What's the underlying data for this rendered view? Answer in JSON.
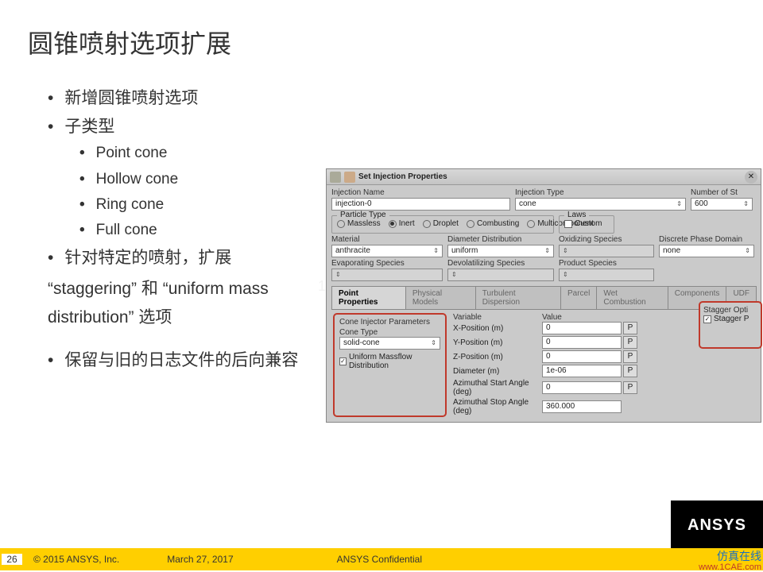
{
  "title": "圆锥喷射选项扩展",
  "bullets": {
    "b1": "新增圆锥喷射选项",
    "b2": "子类型",
    "sub": [
      "Point cone",
      "Hollow cone",
      "Ring cone",
      "Full cone"
    ],
    "b3": "针对特定的喷射，扩展",
    "b3_note": "“staggering” 和 “uniform mass distribution” 选项",
    "b4": "保留与旧的日志文件的后向兼容"
  },
  "dialog": {
    "title": "Set Injection Properties",
    "injection_name_label": "Injection Name",
    "injection_name": "injection-0",
    "injection_type_label": "Injection Type",
    "injection_type": "cone",
    "num_streams_label": "Number of St",
    "num_streams": "600",
    "particle_type_label": "Particle Type",
    "particle_types": [
      "Massless",
      "Inert",
      "Droplet",
      "Combusting",
      "Multicomponent"
    ],
    "selected_particle": "Inert",
    "laws_label": "Laws",
    "laws_custom": "Custom",
    "material_label": "Material",
    "material": "anthracite",
    "diam_dist_label": "Diameter Distribution",
    "diam_dist": "uniform",
    "oxid_label": "Oxidizing Species",
    "dpd_label": "Discrete Phase Domain",
    "dpd": "none",
    "evap_label": "Evaporating Species",
    "devol_label": "Devolatilizing Species",
    "prod_label": "Product Species",
    "tabs": [
      "Point Properties",
      "Physical Models",
      "Turbulent Dispersion",
      "Parcel",
      "Wet Combustion",
      "Components",
      "UDF"
    ],
    "cone_params_label": "Cone Injector Parameters",
    "cone_type_label": "Cone Type",
    "cone_type": "solid-cone",
    "uniform_massflow": "Uniform Massflow Distribution",
    "variable_label": "Variable",
    "value_label": "Value",
    "rows": [
      {
        "var": "X-Position (m)",
        "val": "0"
      },
      {
        "var": "Y-Position (m)",
        "val": "0"
      },
      {
        "var": "Z-Position (m)",
        "val": "0"
      },
      {
        "var": "Diameter (m)",
        "val": "1e-06"
      },
      {
        "var": "Azimuthal Start Angle (deg)",
        "val": "0"
      },
      {
        "var": "Azimuthal Stop Angle (deg)",
        "val": "360.000"
      }
    ],
    "stagger_opt_label": "Stagger Opti",
    "stagger_p": "Stagger P",
    "p_btn": "P"
  },
  "footer": {
    "page": "26",
    "copyright": "© 2015 ANSYS, Inc.",
    "date": "March 27, 2017",
    "confidential": "ANSYS Confidential",
    "logo": "ANSYS",
    "cn": "仿真在线",
    "url": "www.1CAE.com"
  },
  "watermark": "1CAE.com"
}
